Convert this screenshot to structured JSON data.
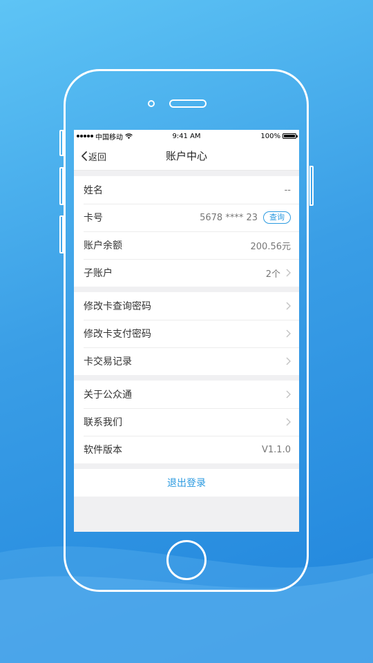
{
  "status_bar": {
    "carrier": "中国移动",
    "time": "9:41 AM",
    "battery": "100%"
  },
  "nav": {
    "back_label": "返回",
    "title": "账户中心"
  },
  "account_group": [
    {
      "label": "姓名",
      "value": "--"
    },
    {
      "label": "卡号",
      "value": "5678 **** 23",
      "action": "查询"
    },
    {
      "label": "账户余额",
      "value": "200.56元"
    },
    {
      "label": "子账户",
      "value": "2个"
    }
  ],
  "card_group": [
    {
      "label": "修改卡查询密码"
    },
    {
      "label": "修改卡支付密码"
    },
    {
      "label": "卡交易记录"
    }
  ],
  "about_group": [
    {
      "label": "关于公众通"
    },
    {
      "label": "联系我们"
    },
    {
      "label": "软件版本",
      "value": "V1.1.0"
    }
  ],
  "logout_label": "退出登录",
  "colors": {
    "accent": "#2b9ae0",
    "background_top": "#5ec4f5",
    "background_bottom": "#1f84dc"
  }
}
